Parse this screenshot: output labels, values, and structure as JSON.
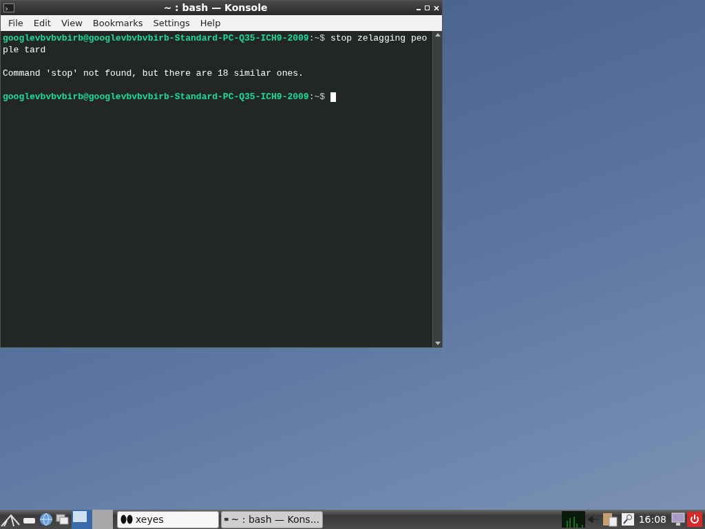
{
  "window": {
    "title": "~ : bash — Konsole"
  },
  "menu": [
    "File",
    "Edit",
    "View",
    "Bookmarks",
    "Settings",
    "Help"
  ],
  "terminal": [
    {
      "kind": "prompt",
      "host": "googlevbvbvbirb@googlevbvbvbirb-Standard-PC-Q35-ICH9-2009",
      "path": ":~$",
      "command": "stop zelagging people tard",
      "cursor": false
    },
    {
      "kind": "output",
      "text": "Command 'stop' not found, but there are 18 similar ones."
    },
    {
      "kind": "prompt",
      "host": "googlevbvbvbirb@googlevbvbvbirb-Standard-PC-Q35-ICH9-2009",
      "path": ":~$",
      "cursor": true
    }
  ],
  "taskbar": {
    "workspaces": [
      {
        "selected": true
      },
      {
        "selected": false
      }
    ],
    "tasks": [
      {
        "label": "xeyes",
        "kind": "eyes",
        "selected": true
      },
      {
        "label": "~ : bash — Kons...",
        "kind": "terminal",
        "selected": false
      }
    ],
    "clock": "16:08"
  }
}
